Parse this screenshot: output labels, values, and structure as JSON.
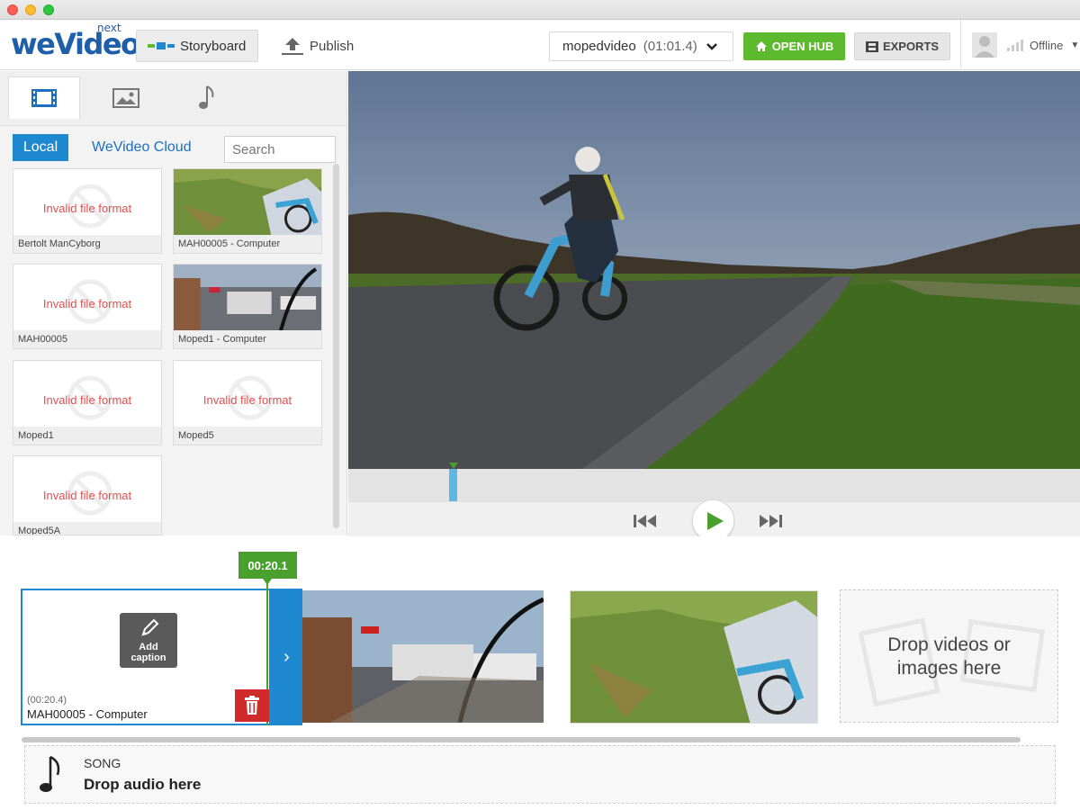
{
  "app": {
    "logo_text": "weVideo",
    "logo_badge": "next"
  },
  "header": {
    "storyboard_label": "Storyboard",
    "publish_label": "Publish",
    "project_name": "mopedvideo",
    "project_duration": "(01:01.4)",
    "open_hub_label": "OPEN HUB",
    "exports_label": "EXPORTS",
    "user_status": "Offline"
  },
  "media_panel": {
    "tab_video_icon": "film-icon",
    "tab_image_icon": "image-icon",
    "tab_audio_icon": "music-note-icon",
    "source_local": "Local",
    "source_cloud": "WeVideo Cloud",
    "search_placeholder": "Search",
    "items": [
      {
        "name": "Bertolt ManCyborg",
        "status": "Invalid file format"
      },
      {
        "name": "MAH00005 - Computer",
        "status": ""
      },
      {
        "name": "MAH00005",
        "status": "Invalid file format"
      },
      {
        "name": "Moped1 - Computer",
        "status": ""
      },
      {
        "name": "Moped1",
        "status": "Invalid file format"
      },
      {
        "name": "Moped5",
        "status": "Invalid file format"
      },
      {
        "name": "Moped5A",
        "status": "Invalid file format"
      }
    ]
  },
  "player": {
    "rewind_icon": "skip-back-icon",
    "play_icon": "play-icon",
    "forward_icon": "skip-forward-icon"
  },
  "timeline": {
    "playhead_time": "00:20.1",
    "selected_clip": {
      "duration": "(00:20.4)",
      "name": "MAH00005 - Computer",
      "caption_label_1": "Add",
      "caption_label_2": "caption"
    },
    "drop_video_1": "Drop videos or",
    "drop_video_2": "images here",
    "song_label": "SONG",
    "drop_audio": "Drop audio here"
  },
  "colors": {
    "accent_blue": "#1e88d0",
    "hub_green": "#5dba2f",
    "playhead_green": "#4aa02c",
    "delete_red": "#d02a2a",
    "invalid_red": "#e05050"
  }
}
